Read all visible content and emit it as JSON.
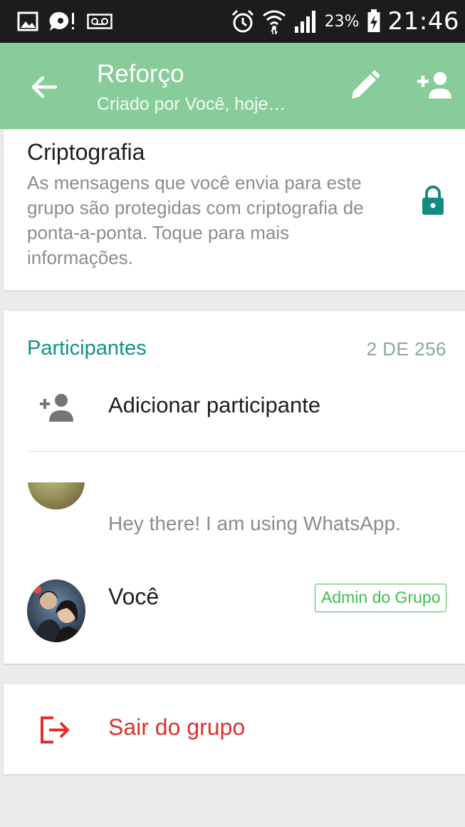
{
  "status_bar": {
    "icons_left": [
      "image-icon",
      "chat-bubble-icon",
      "voicemail-icon"
    ],
    "icons_right": [
      "alarm-icon",
      "wifi-icon",
      "signal-icon",
      "battery-charging-icon"
    ],
    "battery": "23%",
    "time": "21:46"
  },
  "app_bar": {
    "title": "Reforço",
    "subtitle": "Criado por Você, hoje…",
    "accent_color": "#88cc9a"
  },
  "encryption": {
    "title": "Criptografia",
    "description": "As mensagens que você envia para este grupo são protegidas com criptografia de ponta-a-ponta. Toque para mais informações.",
    "icon": "lock-icon",
    "icon_color": "#128c7e"
  },
  "participants": {
    "header": "Participantes",
    "count": "2 DE 256",
    "add_label": "Adicionar participante",
    "members": [
      {
        "name": "",
        "status": "Hey there! I am using WhatsApp."
      },
      {
        "name": "Você",
        "badge": "Admin do Grupo"
      }
    ]
  },
  "exit": {
    "label": "Sair do grupo",
    "color": "#e0312e"
  }
}
